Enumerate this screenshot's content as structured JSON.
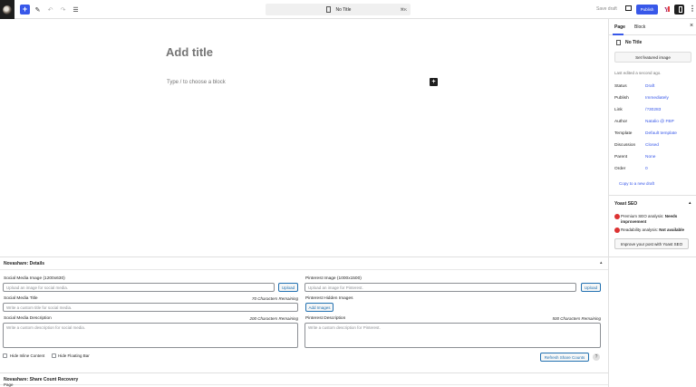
{
  "toolbar": {
    "document_title": "No Title",
    "shortcut": "⌘K",
    "save_draft": "Save draft",
    "publish": "Publish"
  },
  "editor": {
    "title_placeholder": "Add title",
    "block_placeholder": "Type / to choose a block"
  },
  "sidebar": {
    "tabs": [
      {
        "label": "Page",
        "active": true
      },
      {
        "label": "Block",
        "active": false
      }
    ],
    "doc_title": "No Title",
    "featured_image_button": "Set featured image",
    "last_edited": "Last edited a second ago.",
    "rows": [
      {
        "label": "Status",
        "value": "Draft"
      },
      {
        "label": "Publish",
        "value": "Immediately"
      },
      {
        "label": "Link",
        "value": "/?30283"
      },
      {
        "label": "Author",
        "value": "Natalio @ FBP"
      },
      {
        "label": "Template",
        "value": "Default template"
      },
      {
        "label": "Discussion",
        "value": "Closed"
      },
      {
        "label": "Parent",
        "value": "None"
      },
      {
        "label": "Order",
        "value": "0"
      }
    ],
    "copy_link": "Copy to a new draft",
    "yoast": {
      "title": "Yoast SEO",
      "seo_analysis_prefix": "Premium SEO analysis:",
      "seo_analysis_status": "Needs improvement",
      "readability_prefix": "Readability analysis:",
      "readability_status": "Not available",
      "improve_button": "Improve your post with Yoast SEO",
      "status_color": "#dc3232"
    }
  },
  "metabox": {
    "novashare_title": "Novashare: Details",
    "social_image_label": "Social Media Image (1200x630)",
    "social_image_placeholder": "Upload an image for social media.",
    "upload_label": "Upload",
    "social_title_label": "Social Media Title",
    "social_title_remaining": "70 Characters Remaining",
    "social_title_placeholder": "Write a custom title for social media.",
    "social_desc_label": "Social Media Description",
    "social_desc_remaining": "200 Characters Remaining",
    "social_desc_placeholder": "Write a custom description for social media.",
    "pinterest_image_label": "Pinterest Image (1000x1500)",
    "pinterest_image_placeholder": "Upload an image for Pinterest.",
    "pinterest_hidden_label": "Pinterest Hidden Images",
    "add_images_label": "Add Images",
    "pinterest_desc_label": "Pinterest Description",
    "pinterest_desc_remaining": "500 Characters Remaining",
    "pinterest_desc_placeholder": "Write a custom description for Pinterest.",
    "hide_inline_label": "Hide Inline Content",
    "hide_floating_label": "Hide Floating Bar",
    "refresh_label": "Refresh Share Counts",
    "help_glyph": "?",
    "recovery_title": "Novashare: Share Count Recovery",
    "footer_crumb": "Page"
  },
  "colors": {
    "accent": "#3858e9",
    "wp_link": "#2271b1"
  }
}
